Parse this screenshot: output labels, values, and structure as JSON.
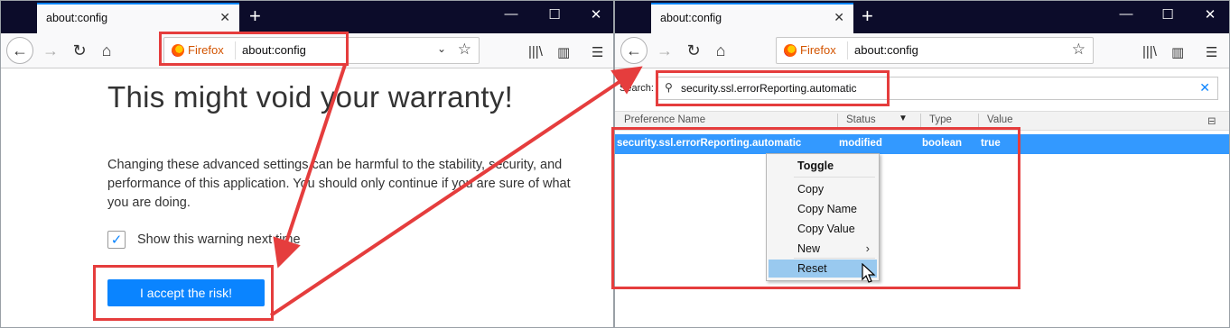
{
  "left": {
    "tab_title": "about:config",
    "tab_close": "✕",
    "new_tab": "+",
    "window_buttons": [
      "—",
      "☐",
      "✕"
    ],
    "identity": "Firefox",
    "url": "about:config",
    "warning_title": "This might void your warranty!",
    "warning_body": "Changing these advanced settings can be harmful to the stability, security, and performance of this application. You should only continue if you are sure of what you are doing.",
    "show_warning_label": "Show this warning next time",
    "show_warning_checked": true,
    "accept_button": "I accept the risk!"
  },
  "right": {
    "tab_title": "about:config",
    "tab_close": "✕",
    "new_tab": "+",
    "window_buttons": [
      "—",
      "☐",
      "✕"
    ],
    "identity": "Firefox",
    "url": "about:config",
    "search_label": "Search:",
    "search_value": "security.ssl.errorReporting.automatic",
    "columns": [
      "Preference Name",
      "Status",
      "Type",
      "Value"
    ],
    "selected_row": {
      "name": "security.ssl.errorReporting.automatic",
      "status": "modified",
      "type": "boolean",
      "value": "true"
    },
    "context_menu": [
      "Toggle",
      "Copy",
      "Copy Name",
      "Copy Value",
      "New",
      "Reset"
    ]
  },
  "colors": {
    "annotation": "#e53d3d",
    "accent": "#0a84ff",
    "selection": "#3399ff",
    "titlebar": "#0c0c2a"
  }
}
